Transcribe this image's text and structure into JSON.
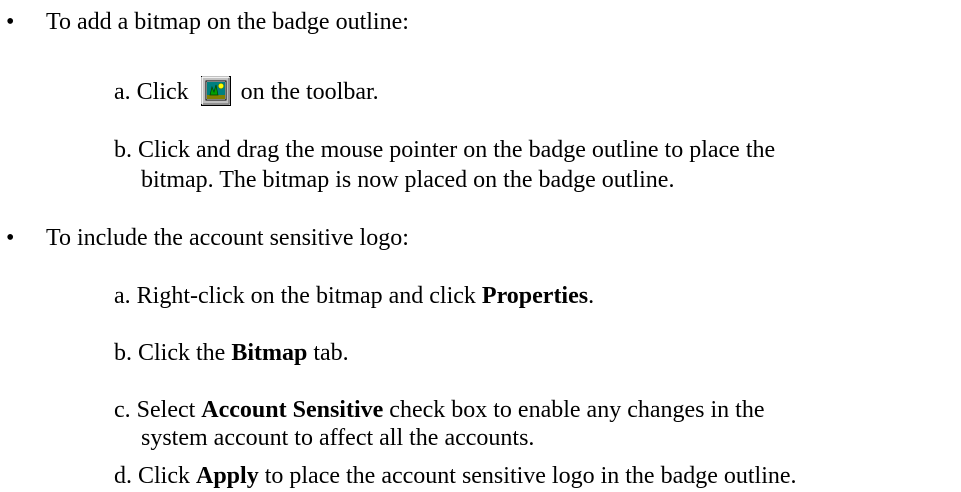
{
  "bullets": [
    {
      "text": "To add a bitmap on the badge outline:",
      "steps": [
        {
          "letter": "a.",
          "before_icon": "Click",
          "icon": "add-bitmap-icon",
          "after_icon": "on the toolbar."
        },
        {
          "letter": "b.",
          "line1": "Click and drag the mouse pointer on the badge outline to place the",
          "line2": "bitmap. The bitmap is now placed on the badge outline."
        }
      ]
    },
    {
      "text": "To include the account sensitive logo:",
      "steps": [
        {
          "letter": "a.",
          "pre": "Right-click on the bitmap and click ",
          "bold": "Properties",
          "post": "."
        },
        {
          "letter": "b.",
          "pre": "Click the ",
          "bold": "Bitmap",
          "post": " tab."
        },
        {
          "letter": "c.",
          "pre": "Select ",
          "bold": "Account Sensitive",
          "post": " check box to enable any changes in the",
          "line2": "system account to affect all the accounts."
        },
        {
          "letter": "d.",
          "pre": "Click ",
          "bold": "Apply",
          "post": " to place the account sensitive logo in the badge outline."
        }
      ]
    }
  ],
  "bullet_symbol": "•"
}
